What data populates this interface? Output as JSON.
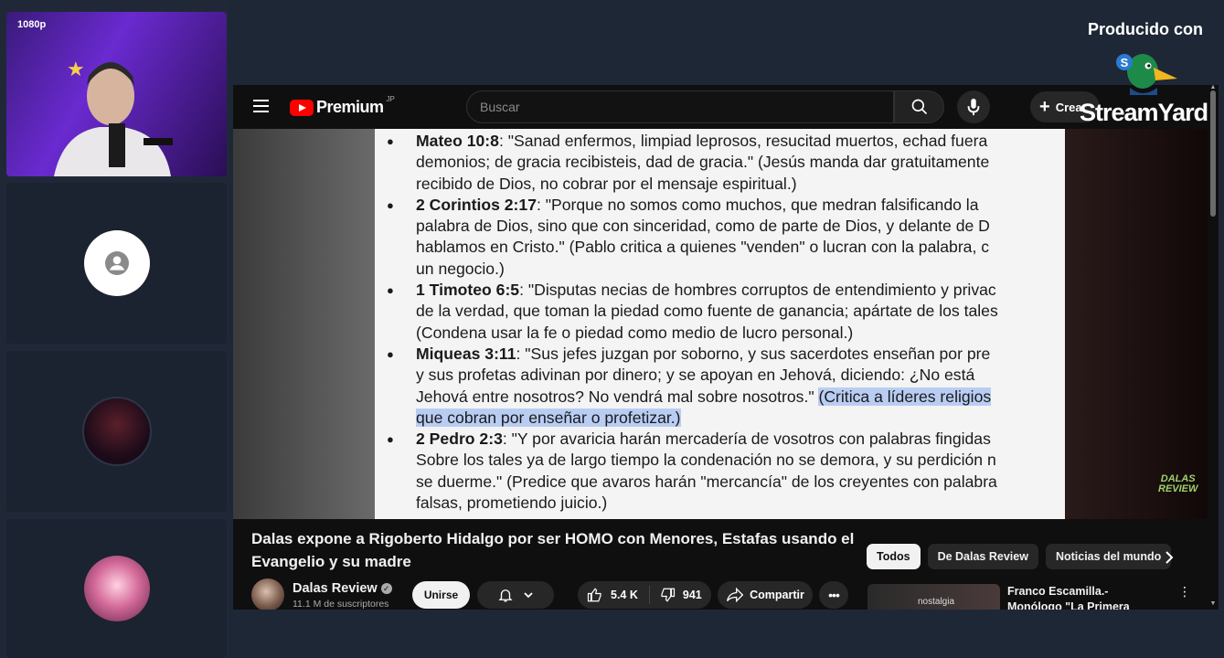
{
  "stream": {
    "resolution_badge": "1080p"
  },
  "youtube": {
    "logo_text": "Premium",
    "logo_region": "JP",
    "search": {
      "placeholder": "Buscar"
    },
    "create_label": "Crear",
    "video": {
      "doc_lines": [
        {
          "bullet": true,
          "ref": "Mateo 10:8",
          "text": ": \"Sanad enfermos, limpiad leprosos, resucitad muertos, echad fuera"
        },
        {
          "bullet": false,
          "ref": "",
          "text": "demonios; de gracia recibisteis, dad de gracia.\" (Jesús manda dar gratuitamente"
        },
        {
          "bullet": false,
          "ref": "",
          "text": "recibido de Dios, no cobrar por el mensaje espiritual.)"
        },
        {
          "bullet": true,
          "ref": "2 Corintios 2:17",
          "text": ": \"Porque no somos como muchos, que medran falsificando la"
        },
        {
          "bullet": false,
          "ref": "",
          "text": "palabra de Dios, sino que con sinceridad, como de parte de Dios, y delante de D"
        },
        {
          "bullet": false,
          "ref": "",
          "text": "hablamos en Cristo.\" (Pablo critica a quienes \"venden\" o lucran con la palabra, c"
        },
        {
          "bullet": false,
          "ref": "",
          "text": "un negocio.)"
        },
        {
          "bullet": true,
          "ref": "1 Timoteo 6:5",
          "text": ": \"Disputas necias de hombres corruptos de entendimiento y privac"
        },
        {
          "bullet": false,
          "ref": "",
          "text": "de la verdad, que toman la piedad como fuente de ganancia; apártate de los tales"
        },
        {
          "bullet": false,
          "ref": "",
          "text": "(Condena usar la fe o piedad como medio de lucro personal.)"
        },
        {
          "bullet": true,
          "ref": "Miqueas 3:11",
          "text": ": \"Sus jefes juzgan por soborno, y sus sacerdotes enseñan por pre"
        },
        {
          "bullet": false,
          "ref": "",
          "text": "y sus profetas adivinan por dinero; y se apoyan en Jehová, diciendo: ¿No está"
        },
        {
          "bullet": false,
          "ref": "",
          "text": "Jehová entre nosotros? No vendrá mal sobre nosotros.\" ",
          "highlight": "(Critica a líderes religios"
        },
        {
          "bullet": false,
          "ref": "",
          "text": "",
          "highlight": "que cobran por enseñar o profetizar.)"
        },
        {
          "bullet": true,
          "ref": "2 Pedro 2:3",
          "text": ": \"Y por avaricia harán mercadería de vosotros con palabras fingidas"
        },
        {
          "bullet": false,
          "ref": "",
          "text": "Sobre los tales ya de largo tiempo la condenación no se demora, y su perdición n"
        },
        {
          "bullet": false,
          "ref": "",
          "text": "se duerme.\" (Predice que avaros harán \"mercancía\" de los creyentes con palabra"
        },
        {
          "bullet": false,
          "ref": "",
          "text": "falsas, prometiendo juicio.)"
        }
      ],
      "watermark_line1": "DALAS",
      "watermark_line2": "REVIEW"
    },
    "title": "Dalas expone a Rigoberto Hidalgo por ser HOMO con Menores, Estafas usando el Evangelio y su madre",
    "channel": {
      "name": "Dalas Review",
      "subscribers": "11.1 M de suscriptores",
      "join_label": "Unirse"
    },
    "actions": {
      "likes": "5.4 K",
      "dislikes": "941",
      "share_label": "Compartir"
    },
    "chips": [
      "Todos",
      "De Dalas Review",
      "Noticias del mundo"
    ],
    "recommendation": {
      "thumb_text": "nostalgia",
      "title": "Franco Escamilla.- Monólogo \"La Primera Noche\""
    }
  },
  "branding": {
    "produced_with": "Producido con",
    "brand_name": "StreamYard"
  },
  "colors": {
    "background": "#1e2736",
    "youtube_red": "#ff0000",
    "highlight": "#b9cdf3"
  }
}
